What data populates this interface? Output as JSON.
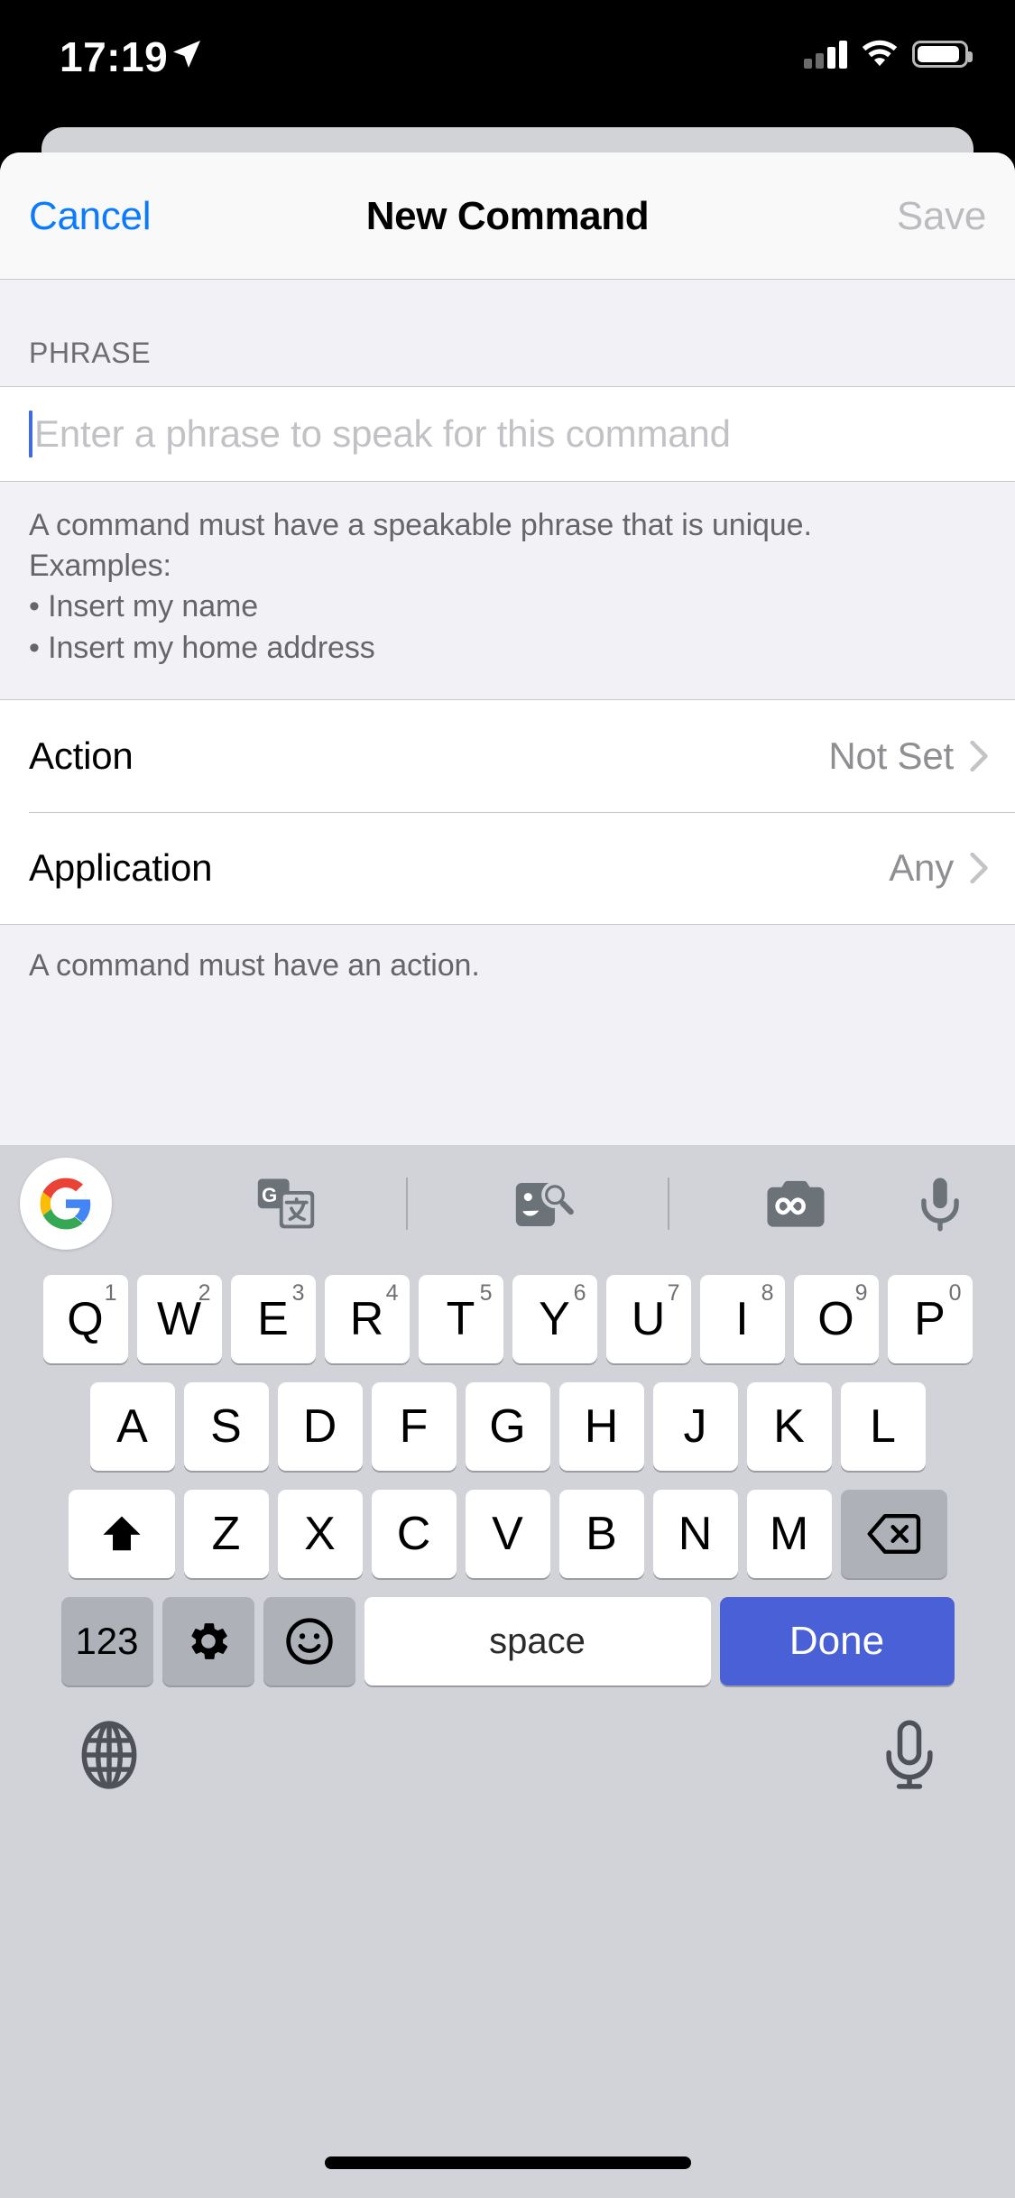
{
  "status_bar": {
    "time": "17:19",
    "location_icon": "location-arrow-icon",
    "signal_icon": "cellular-signal-icon",
    "wifi_icon": "wifi-icon",
    "battery_icon": "battery-icon"
  },
  "nav": {
    "cancel_label": "Cancel",
    "title": "New Command",
    "save_label": "Save",
    "cancel_color": "#0b7bfd",
    "save_color": "#bcbcc0"
  },
  "form": {
    "phrase_section_header": "PHRASE",
    "phrase_placeholder": "Enter a phrase to speak for this command",
    "phrase_value": "",
    "phrase_help": [
      "A command must have a speakable phrase that is unique.",
      "Examples:",
      "• Insert my name",
      "• Insert my home address"
    ],
    "rows": [
      {
        "label": "Action",
        "value": "Not Set"
      },
      {
        "label": "Application",
        "value": "Any"
      }
    ],
    "action_help": "A command must have an action."
  },
  "keyboard": {
    "toolbar": [
      {
        "name": "google-logo-icon",
        "label": "G"
      },
      {
        "name": "translate-icon",
        "label": ""
      },
      {
        "name": "divider",
        "label": ""
      },
      {
        "name": "sticker-search-icon",
        "label": ""
      },
      {
        "name": "divider",
        "label": ""
      },
      {
        "name": "gif-camera-icon",
        "label": ""
      },
      {
        "name": "microphone-icon",
        "label": ""
      }
    ],
    "row1": [
      {
        "k": "Q",
        "sup": "1"
      },
      {
        "k": "W",
        "sup": "2"
      },
      {
        "k": "E",
        "sup": "3"
      },
      {
        "k": "R",
        "sup": "4"
      },
      {
        "k": "T",
        "sup": "5"
      },
      {
        "k": "Y",
        "sup": "6"
      },
      {
        "k": "U",
        "sup": "7"
      },
      {
        "k": "I",
        "sup": "8"
      },
      {
        "k": "O",
        "sup": "9"
      },
      {
        "k": "P",
        "sup": "0"
      }
    ],
    "row2": [
      "A",
      "S",
      "D",
      "F",
      "G",
      "H",
      "J",
      "K",
      "L"
    ],
    "row3": [
      "Z",
      "X",
      "C",
      "V",
      "B",
      "N",
      "M"
    ],
    "shift_label": "shift-icon",
    "backspace_label": "backspace-icon",
    "numbers_key": "123",
    "settings_key": "gear-icon",
    "emoji_key": "emoji-icon",
    "space_key": "space",
    "done_key": "Done",
    "done_color": "#4a60d6",
    "globe_key": "globe-icon",
    "mic_key": "microphone-icon"
  }
}
